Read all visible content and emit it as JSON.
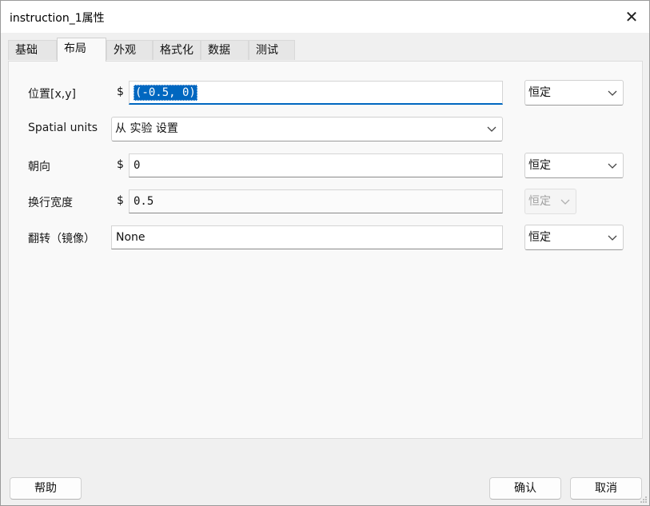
{
  "window": {
    "title": "instruction_1属性",
    "close_glyph": "✕"
  },
  "tabs": [
    {
      "label": "基础",
      "active": false
    },
    {
      "label": "布局",
      "active": true
    },
    {
      "label": "外观",
      "active": false
    },
    {
      "label": "格式化",
      "active": false
    },
    {
      "label": "数据",
      "active": false
    },
    {
      "label": "测试",
      "active": false
    }
  ],
  "fields": {
    "position": {
      "label": "位置[x,y]",
      "prefix": "$",
      "value": "(-0.5, 0)",
      "mode": "恒定"
    },
    "spatial_units": {
      "label": "Spatial units",
      "value": "从 实验 设置"
    },
    "orientation": {
      "label": "朝向",
      "prefix": "$",
      "value": "0",
      "mode": "恒定"
    },
    "wrap_width": {
      "label": "换行宽度",
      "prefix": "$",
      "value": "0.5",
      "mode": "恒定"
    },
    "flip": {
      "label": "翻转（镜像）",
      "value": "None",
      "mode": "恒定"
    }
  },
  "buttons": {
    "help": "帮助",
    "ok": "确认",
    "cancel": "取消"
  },
  "icons": {
    "close": "close-icon",
    "dropdown": "chevron-down-icon",
    "resize": "resize-grip-icon"
  },
  "colors": {
    "accent": "#0067c0",
    "panel": "#f9f9f9",
    "background": "#f0f0f0"
  }
}
